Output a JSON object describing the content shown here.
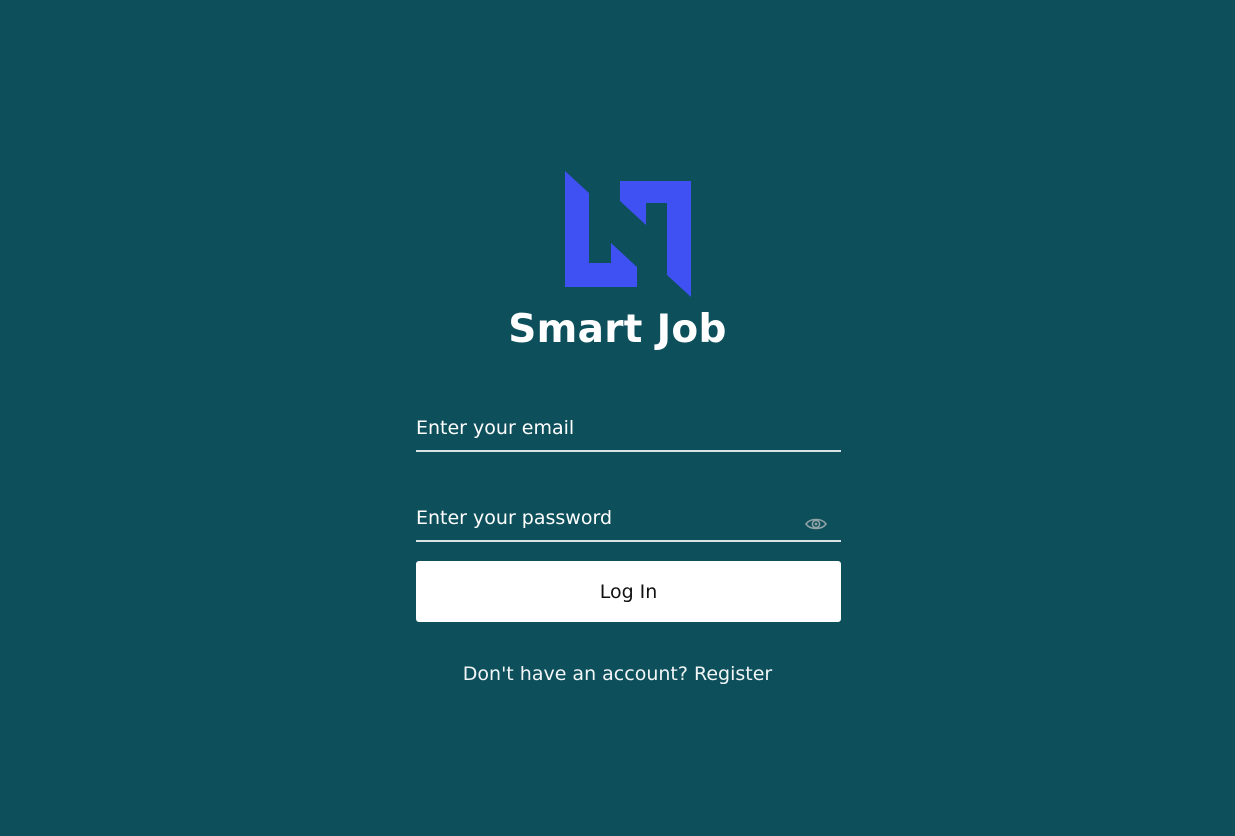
{
  "app": {
    "title": "Smart Job",
    "logo_icon": "smart-job-logo",
    "brand_color": "#3f51f2",
    "background_color": "#0d4f5b"
  },
  "login_form": {
    "email_placeholder": "Enter your email",
    "password_placeholder": "Enter your password",
    "password_toggle_icon": "eye-icon",
    "submit_label": "Log In"
  },
  "footer": {
    "prompt_text": "Don't have an account?",
    "register_label": "Register"
  }
}
